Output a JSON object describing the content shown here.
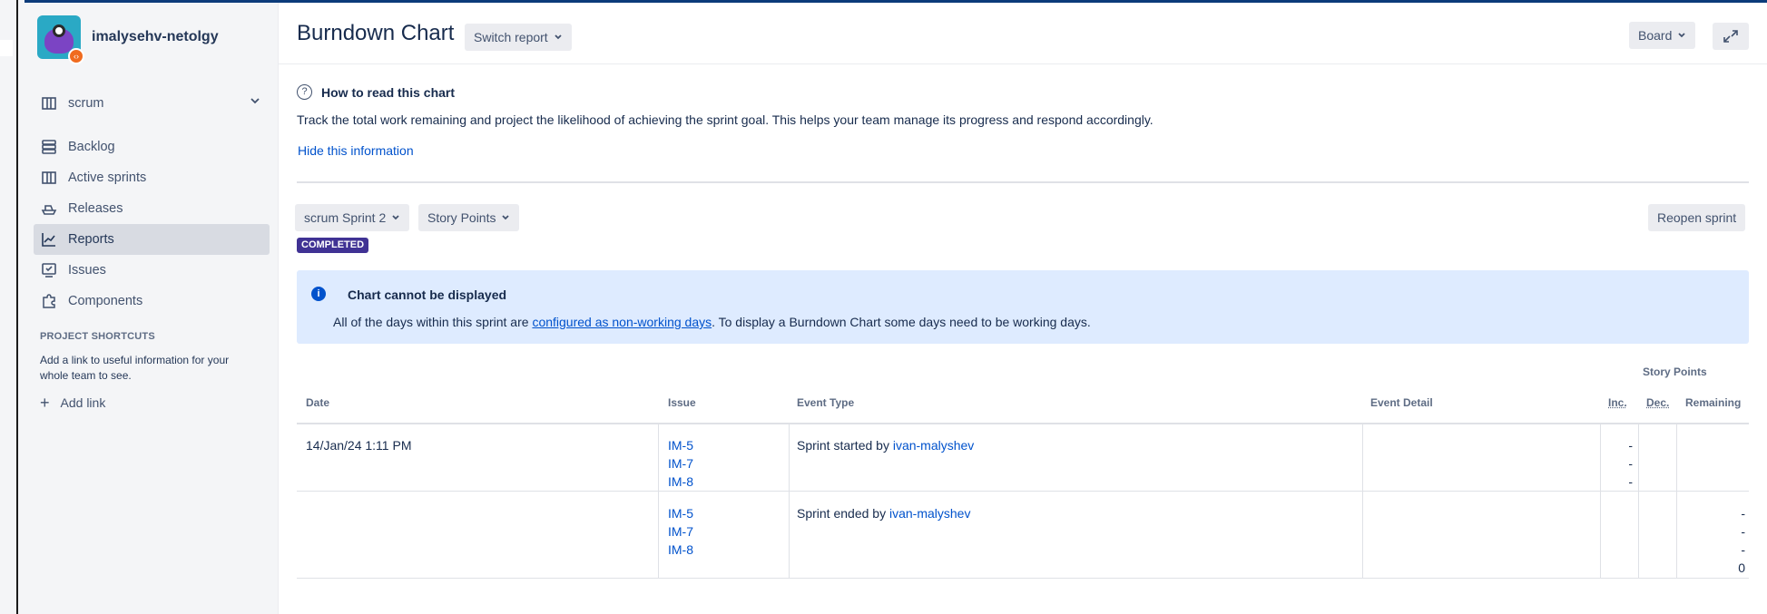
{
  "sidebar": {
    "project_name": "imalysehv-netolgy",
    "board_select": "scrum",
    "items": [
      {
        "label": "Backlog"
      },
      {
        "label": "Active sprints"
      },
      {
        "label": "Releases"
      },
      {
        "label": "Reports"
      },
      {
        "label": "Issues"
      },
      {
        "label": "Components"
      }
    ],
    "active_item": "Reports",
    "shortcuts_title": "PROJECT SHORTCUTS",
    "shortcuts_text": "Add a link to useful information for your whole team to see.",
    "add_link_label": "Add link"
  },
  "header": {
    "title": "Burndown Chart",
    "switch_report_label": "Switch report",
    "board_label": "Board"
  },
  "info": {
    "title": "How to read this chart",
    "description": "Track the total work remaining and project the likelihood of achieving the sprint goal. This helps your team manage its progress and respond accordingly.",
    "hide_link": "Hide this information"
  },
  "controls": {
    "sprint_select": "scrum Sprint 2",
    "estimation_select": "Story Points",
    "reopen_label": "Reopen sprint",
    "status_lozenge": "COMPLETED"
  },
  "message": {
    "title": "Chart cannot be displayed",
    "text_before": "All of the days within this sprint are ",
    "link_text": "configured as non-working days",
    "text_after": ". To display a Burndown Chart some days need to be working days."
  },
  "table": {
    "group_header": "Story Points",
    "columns": {
      "date": "Date",
      "issue": "Issue",
      "event_type": "Event Type",
      "event_detail": "Event Detail",
      "inc": "Inc.",
      "dec": "Dec.",
      "remaining": "Remaining"
    },
    "rows": [
      {
        "date": "14/Jan/24 1:11 PM",
        "issues": [
          "IM-5",
          "IM-7",
          "IM-8"
        ],
        "event_text": "Sprint started by ",
        "event_user": "ivan-malyshev",
        "inc": [
          "-",
          "-",
          "-"
        ],
        "remaining": []
      },
      {
        "date": "",
        "issues": [
          "IM-5",
          "IM-7",
          "IM-8"
        ],
        "event_text": "Sprint ended by ",
        "event_user": "ivan-malyshev",
        "inc": [],
        "remaining": [
          "-",
          "-",
          "-",
          "0"
        ]
      }
    ]
  },
  "colors": {
    "accent": "#0052cc",
    "lozenge": "#403294",
    "message_bg": "#deebff",
    "sidebar_active": "#d8dbe2"
  }
}
